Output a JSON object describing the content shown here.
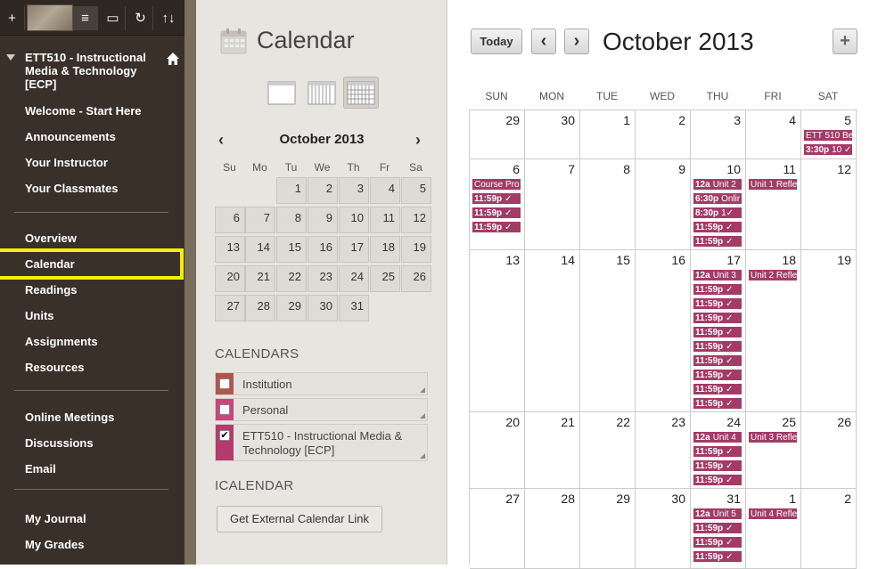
{
  "toolbar": {
    "add": "+",
    "menu": "≡",
    "window": "▭",
    "refresh": "↻",
    "sort": "↑↓"
  },
  "course": {
    "title": "ETT510 - Instructional Media & Technology [ECP]"
  },
  "nav": {
    "group1": [
      "Welcome - Start Here",
      "Announcements",
      "Your Instructor",
      "Your Classmates"
    ],
    "group2": [
      "Overview",
      "Calendar",
      "Readings",
      "Units",
      "Assignments",
      "Resources"
    ],
    "group3": [
      "Online Meetings",
      "Discussions",
      "Email"
    ],
    "group4": [
      "My Journal",
      "My Grades"
    ]
  },
  "page_title": "Calendar",
  "mini": {
    "title": "October 2013",
    "dow": [
      "Su",
      "Mo",
      "Tu",
      "We",
      "Th",
      "Fr",
      "Sa"
    ],
    "days": [
      "1",
      "2",
      "3",
      "4",
      "5",
      "6",
      "7",
      "8",
      "9",
      "10",
      "11",
      "12",
      "13",
      "14",
      "15",
      "16",
      "17",
      "18",
      "19",
      "20",
      "21",
      "22",
      "23",
      "24",
      "25",
      "26",
      "27",
      "28",
      "29",
      "30",
      "31"
    ]
  },
  "calendars": {
    "heading": "CALENDARS",
    "items": [
      {
        "label": "Institution",
        "color": "#b4544f",
        "checked": false
      },
      {
        "label": "Personal",
        "color": "#c9457e",
        "checked": false
      },
      {
        "label": "ETT510 - Instructional Media & Technology [ECP]",
        "color": "#b33b6e",
        "checked": true
      }
    ]
  },
  "icalendar": {
    "heading": "ICALENDAR",
    "button": "Get External Calendar Link"
  },
  "main": {
    "today": "Today",
    "prev": "‹",
    "next": "›",
    "add": "+",
    "title": "October 2013",
    "dow": [
      "SUN",
      "MON",
      "TUE",
      "WED",
      "THU",
      "FRI",
      "SAT"
    ],
    "weeks": [
      [
        {
          "d": "29",
          "ev": []
        },
        {
          "d": "30",
          "ev": []
        },
        {
          "d": "1",
          "ev": []
        },
        {
          "d": "2",
          "ev": []
        },
        {
          "d": "3",
          "ev": []
        },
        {
          "d": "4",
          "ev": []
        },
        {
          "d": "5",
          "ev": [
            {
              "t": "",
              "s": "ETT 510 Be"
            },
            {
              "t": "3:30p",
              "s": "10 ✓"
            }
          ]
        }
      ],
      [
        {
          "d": "6",
          "ev": [
            {
              "t": "",
              "s": "Course Pro"
            },
            {
              "t": "11:59p",
              "s": "✓"
            },
            {
              "t": "11:59p",
              "s": "✓"
            },
            {
              "t": "11:59p",
              "s": "✓"
            }
          ]
        },
        {
          "d": "7",
          "ev": []
        },
        {
          "d": "8",
          "ev": []
        },
        {
          "d": "9",
          "ev": []
        },
        {
          "d": "10",
          "ev": [
            {
              "t": "12a",
              "s": "Unit 2"
            },
            {
              "t": "6:30p",
              "s": "Onlir"
            },
            {
              "t": "8:30p",
              "s": "1✓"
            },
            {
              "t": "11:59p",
              "s": "✓"
            },
            {
              "t": "11:59p",
              "s": "✓"
            }
          ]
        },
        {
          "d": "11",
          "ev": [
            {
              "t": "",
              "s": "Unit 1 Refle"
            }
          ]
        },
        {
          "d": "12",
          "ev": []
        }
      ],
      [
        {
          "d": "13",
          "ev": []
        },
        {
          "d": "14",
          "ev": []
        },
        {
          "d": "15",
          "ev": []
        },
        {
          "d": "16",
          "ev": []
        },
        {
          "d": "17",
          "ev": [
            {
              "t": "12a",
              "s": "Unit 3"
            },
            {
              "t": "11:59p",
              "s": "✓"
            },
            {
              "t": "11:59p",
              "s": "✓"
            },
            {
              "t": "11:59p",
              "s": "✓"
            },
            {
              "t": "11:59p",
              "s": "✓"
            },
            {
              "t": "11:59p",
              "s": "✓"
            },
            {
              "t": "11:59p",
              "s": "✓"
            },
            {
              "t": "11:59p",
              "s": "✓"
            },
            {
              "t": "11:59p",
              "s": "✓"
            },
            {
              "t": "11:59p",
              "s": "✓"
            }
          ]
        },
        {
          "d": "18",
          "ev": [
            {
              "t": "",
              "s": "Unit 2 Refle"
            }
          ]
        },
        {
          "d": "19",
          "ev": []
        }
      ],
      [
        {
          "d": "20",
          "ev": []
        },
        {
          "d": "21",
          "ev": []
        },
        {
          "d": "22",
          "ev": []
        },
        {
          "d": "23",
          "ev": []
        },
        {
          "d": "24",
          "ev": [
            {
              "t": "12a",
              "s": "Unit 4"
            },
            {
              "t": "11:59p",
              "s": "✓"
            },
            {
              "t": "11:59p",
              "s": "✓"
            },
            {
              "t": "11:59p",
              "s": "✓"
            }
          ]
        },
        {
          "d": "25",
          "ev": [
            {
              "t": "",
              "s": "Unit 3 Refle"
            }
          ]
        },
        {
          "d": "26",
          "ev": []
        }
      ],
      [
        {
          "d": "27",
          "ev": []
        },
        {
          "d": "28",
          "ev": []
        },
        {
          "d": "29",
          "ev": []
        },
        {
          "d": "30",
          "ev": []
        },
        {
          "d": "31",
          "ev": [
            {
              "t": "12a",
              "s": "Unit 5"
            },
            {
              "t": "11:59p",
              "s": "✓"
            },
            {
              "t": "11:59p",
              "s": "✓"
            },
            {
              "t": "11:59p",
              "s": "✓"
            }
          ]
        },
        {
          "d": "1",
          "ev": [
            {
              "t": "",
              "s": "Unit 4 Refle"
            }
          ]
        },
        {
          "d": "2",
          "ev": []
        }
      ]
    ]
  }
}
